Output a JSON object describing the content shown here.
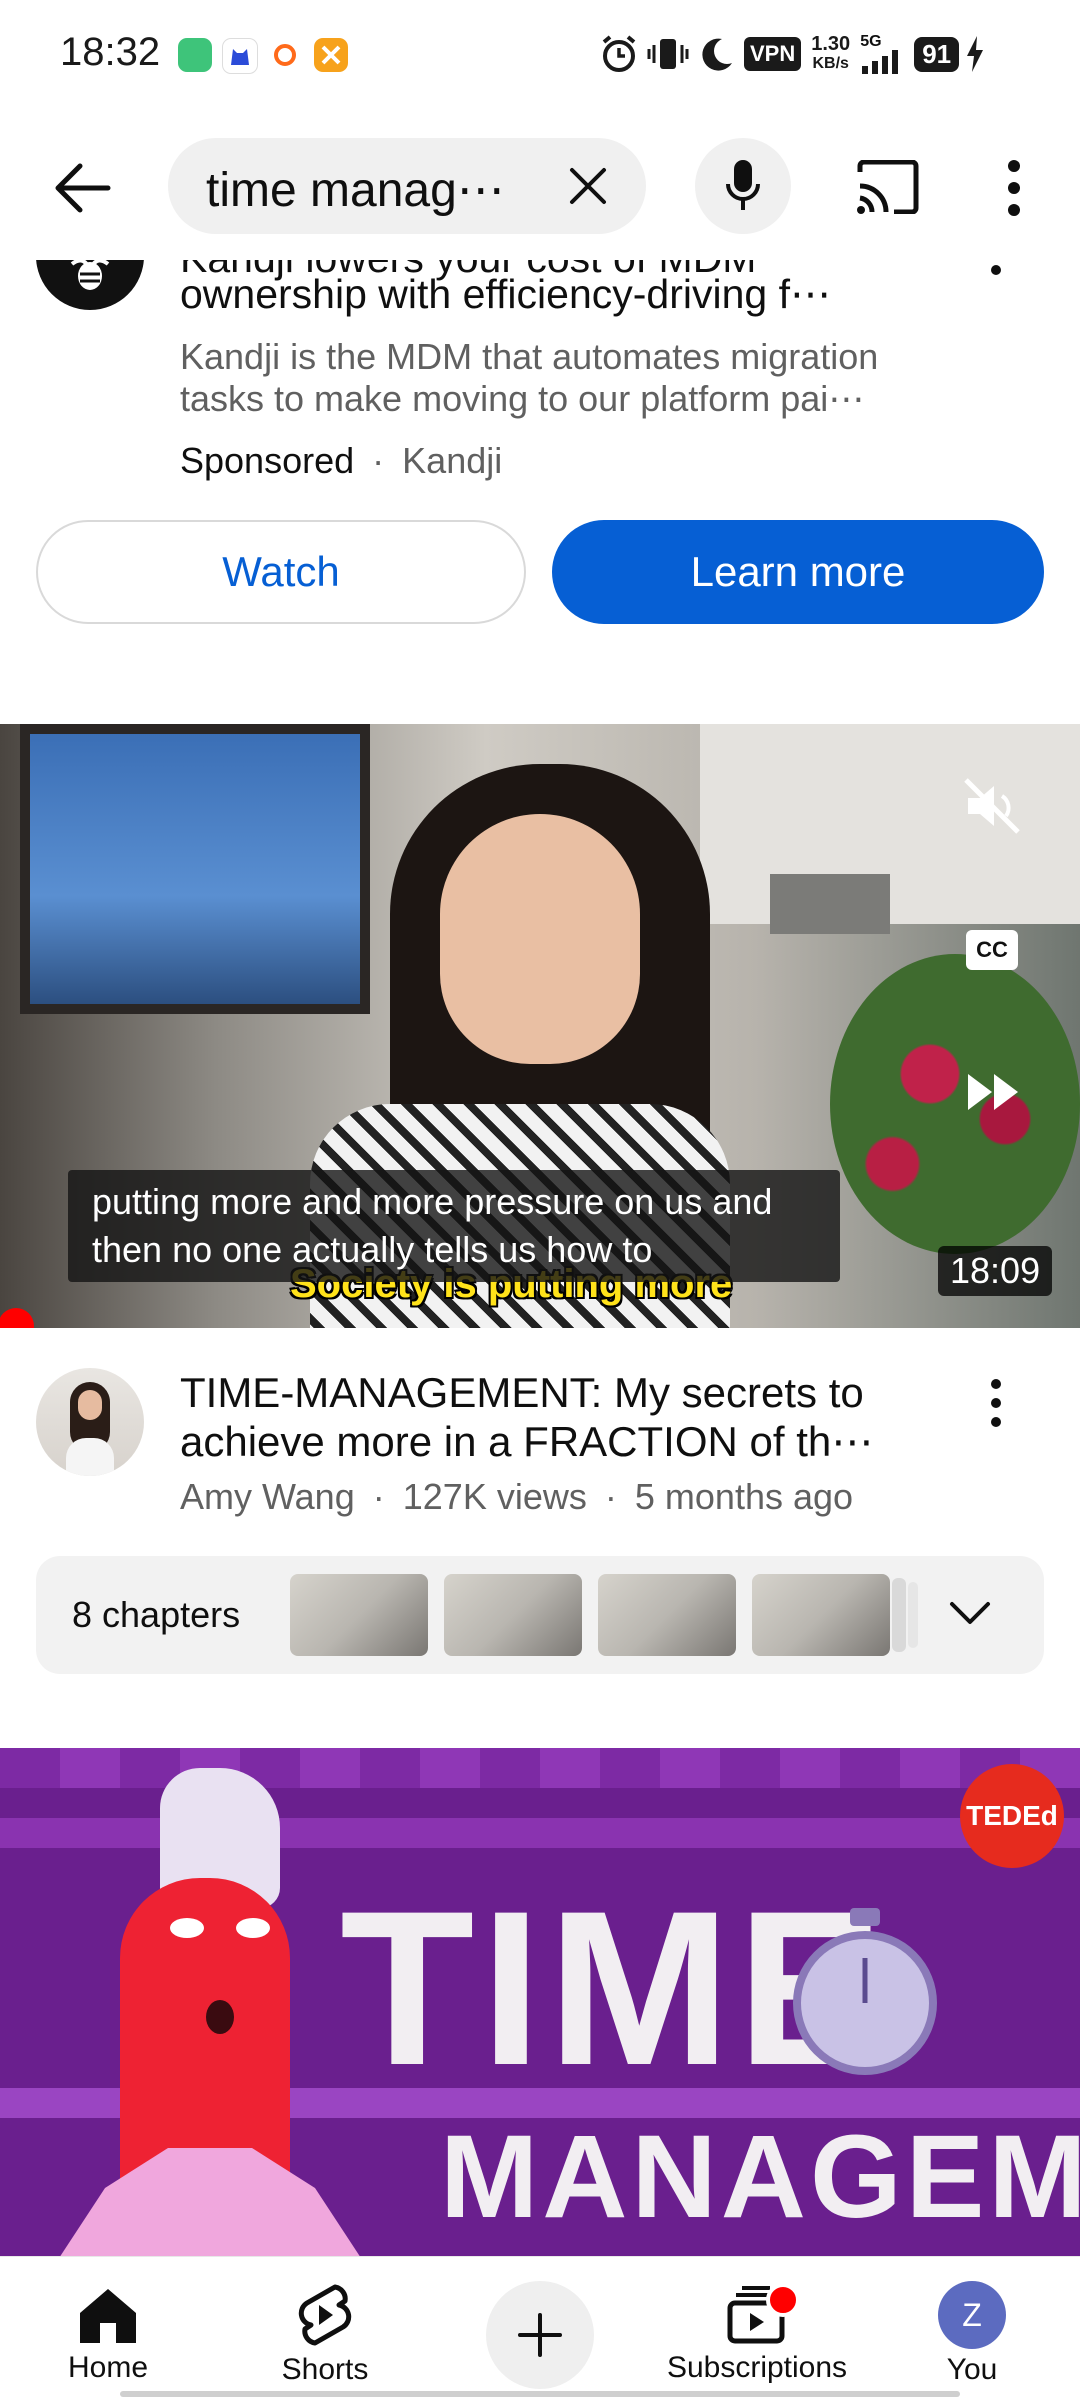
{
  "status_bar": {
    "time": "18:32",
    "network_speed_value": "1.30",
    "network_speed_unit": "KB/s",
    "network_type": "5G",
    "vpn_label": "VPN",
    "battery": "91"
  },
  "search": {
    "query": "time manag⋯"
  },
  "ad": {
    "title_line1_partial": "Kandji lowers your cost of MDM",
    "title_line2": "ownership with efficiency-driving f⋯",
    "description_line1": "Kandji is the MDM that automates migration",
    "description_line2": "tasks to make moving to our platform pai⋯",
    "sponsored_label": "Sponsored",
    "separator": "·",
    "advertiser": "Kandji",
    "watch_button": "Watch",
    "learn_more_button": "Learn more"
  },
  "video1": {
    "caption_line1": "putting more and more pressure on us and",
    "caption_line2": "then no one actually tells us how to",
    "burned_subtitle": "Society is putting more",
    "cc_label": "CC",
    "duration": "18:09",
    "title_line1": "TIME-MANAGEMENT: My secrets to",
    "title_line2": "achieve more in a FRACTION of th⋯",
    "channel": "Amy Wang",
    "views": "127K views",
    "age": "5 months ago",
    "chapters_label": "8 chapters"
  },
  "video2": {
    "badge": "TEDEd",
    "title_big1": "TIME",
    "title_big2": "MANAGEMENT"
  },
  "bottom_nav": {
    "home": "Home",
    "shorts": "Shorts",
    "subscriptions": "Subscriptions",
    "you": "You",
    "avatar_letter": "Z"
  },
  "colors": {
    "accent_blue": "#065fd4",
    "notification_red": "#ff0000",
    "ted_red": "#e62b1e",
    "avatar_purple": "#5c6bc0"
  }
}
